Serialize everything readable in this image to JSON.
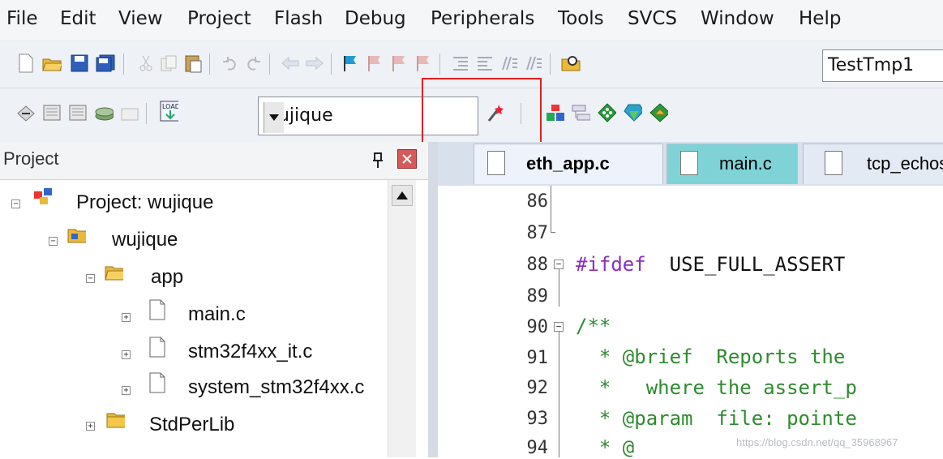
{
  "menu": [
    "File",
    "Edit",
    "View",
    "Project",
    "Flash",
    "Debug",
    "Peripherals",
    "Tools",
    "SVCS",
    "Window",
    "Help"
  ],
  "toolbar1": {
    "icons": [
      "new-file-icon",
      "open-folder-icon",
      "save-icon",
      "save-all-icon",
      "cut-icon",
      "copy-icon",
      "paste-icon",
      "undo-icon",
      "redo-icon",
      "nav-back-icon",
      "nav-forward-icon",
      "bookmark-icon",
      "prev-bookmark-icon",
      "next-bookmark-icon",
      "clear-bookmarks-icon",
      "indent-icon",
      "unindent-icon",
      "comment-icon",
      "uncomment-icon",
      "find-in-files-icon"
    ],
    "find_value": "TestTmp1"
  },
  "toolbar2": {
    "icons": [
      "translate-icon",
      "build-icon",
      "rebuild-icon",
      "batch-build-icon",
      "stop-build-icon",
      "download-icon",
      "options-for-target-icon",
      "manage-project-items-icon",
      "select-packs-icon",
      "manage-runtime-icon",
      "pack-installer-icon",
      "pack-update-icon"
    ],
    "target_value": "wujique"
  },
  "project": {
    "title": "Project",
    "pin_icon": "pin-icon",
    "close_icon": "close-icon",
    "tree": [
      {
        "label": "Project: wujique",
        "icon": "project-icon",
        "expander": "−"
      },
      {
        "label": "wujique",
        "icon": "target-folder-icon",
        "expander": "−"
      },
      {
        "label": "app",
        "icon": "folder-open-icon",
        "expander": "−"
      },
      {
        "label": "main.c",
        "icon": "file-icon",
        "expander": "+"
      },
      {
        "label": "stm32f4xx_it.c",
        "icon": "file-icon",
        "expander": "+"
      },
      {
        "label": "system_stm32f4xx.c",
        "icon": "file-icon",
        "expander": "+"
      },
      {
        "label": "StdPerLib",
        "icon": "folder-icon",
        "expander": "+"
      }
    ]
  },
  "tabs": [
    {
      "label": "eth_app.c",
      "active": true
    },
    {
      "label": "main.c",
      "active": false
    },
    {
      "label": "tcp_echose",
      "active": false
    }
  ],
  "editor": {
    "lines": [
      {
        "num": "86",
        "code": "",
        "fold": ""
      },
      {
        "num": "87",
        "code": "",
        "fold": ""
      },
      {
        "num": "88",
        "code": "#ifdef  USE_FULL_ASSERT",
        "fold": "−"
      },
      {
        "num": "89",
        "code": "",
        "fold": ""
      },
      {
        "num": "90",
        "code": "/**",
        "fold": "−"
      },
      {
        "num": "91",
        "code": "  * @brief  Reports the",
        "fold": ""
      },
      {
        "num": "92",
        "code": "  *   where the assert_p",
        "fold": ""
      },
      {
        "num": "93",
        "code": "  * @param  file: pointe",
        "fold": ""
      },
      {
        "num": "94",
        "code": "  * @",
        "fold": ""
      }
    ]
  },
  "watermark": "https://blog.csdn.net/qq_35968967"
}
